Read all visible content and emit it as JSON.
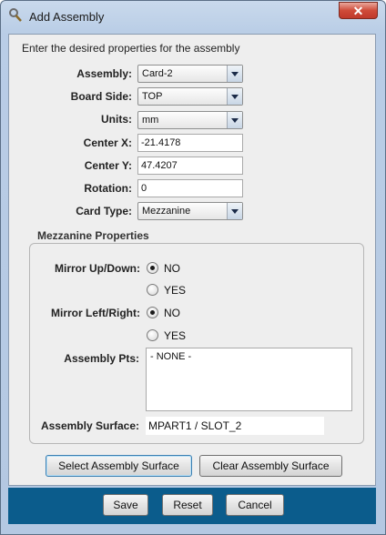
{
  "window": {
    "title": "Add Assembly",
    "close_label": "✕"
  },
  "intro": "Enter the desired properties for the assembly",
  "form": {
    "assembly": {
      "label": "Assembly:",
      "value": "Card-2"
    },
    "board_side": {
      "label": "Board Side:",
      "value": "TOP"
    },
    "units": {
      "label": "Units:",
      "value": "mm"
    },
    "center_x": {
      "label": "Center X:",
      "value": "-21.4178"
    },
    "center_y": {
      "label": "Center Y:",
      "value": "47.4207"
    },
    "rotation": {
      "label": "Rotation:",
      "value": "0"
    },
    "card_type": {
      "label": "Card Type:",
      "value": "Mezzanine"
    }
  },
  "mezzanine": {
    "title": "Mezzanine Properties",
    "mirror_updown": {
      "label": "Mirror Up/Down:",
      "options": [
        "NO",
        "YES"
      ],
      "selected": "NO"
    },
    "mirror_leftright": {
      "label": "Mirror Left/Right:",
      "options": [
        "NO",
        "YES"
      ],
      "selected": "NO"
    },
    "assembly_pts": {
      "label": "Assembly Pts:",
      "value": "- NONE -"
    },
    "assembly_surface": {
      "label": "Assembly Surface:",
      "value": "MPART1 / SLOT_2"
    }
  },
  "actions": {
    "select_surface": "Select Assembly Surface",
    "clear_surface": "Clear Assembly Surface"
  },
  "footer": {
    "save": "Save",
    "reset": "Reset",
    "cancel": "Cancel"
  }
}
